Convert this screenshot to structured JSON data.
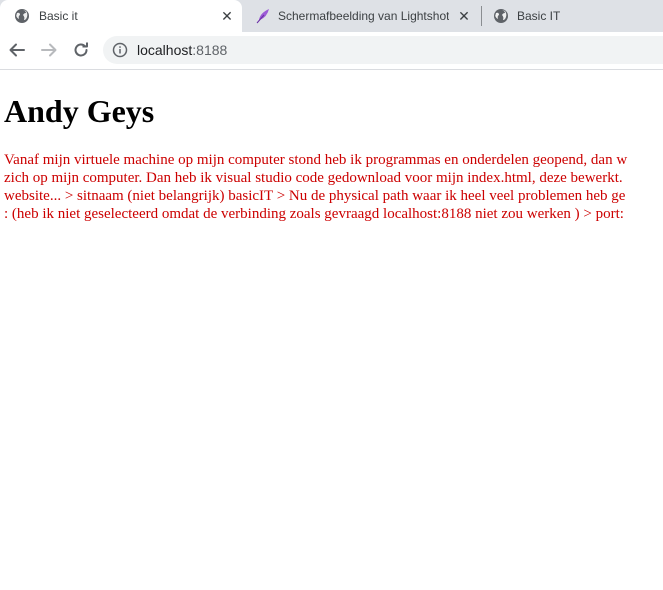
{
  "browser": {
    "tabs": [
      {
        "title": "Basic it",
        "icon": "globe-icon",
        "active": true
      },
      {
        "title": "Schermafbeelding van Lightshot",
        "icon": "feather-icon",
        "active": false
      },
      {
        "title": "Basic IT",
        "icon": "globe-icon",
        "active": false
      }
    ],
    "url": {
      "host": "localhost",
      "port": ":8188"
    }
  },
  "page": {
    "heading": "Andy Geys",
    "paragraph_lines": [
      "Vanaf mijn virtuele machine op mijn computer stond heb ik programmas en onderdelen geopend, dan w",
      "zich op mijn computer. Dan heb ik visual studio code gedownload voor mijn index.html, deze bewerkt.",
      "website... > sitnaam (niet belangrijk) basicIT > Nu de physical path waar ik heel veel problemen heb ge",
      ": (heb ik niet geselecteerd omdat de verbinding zoals gevraagd localhost:8188 niet zou werken ) > port:"
    ]
  },
  "colors": {
    "paragraph_text": "#cc0000",
    "tabbar_bg": "#dee1e6",
    "omnibox_bg": "#f1f3f4",
    "feather_icon": "#9c5bd6"
  }
}
